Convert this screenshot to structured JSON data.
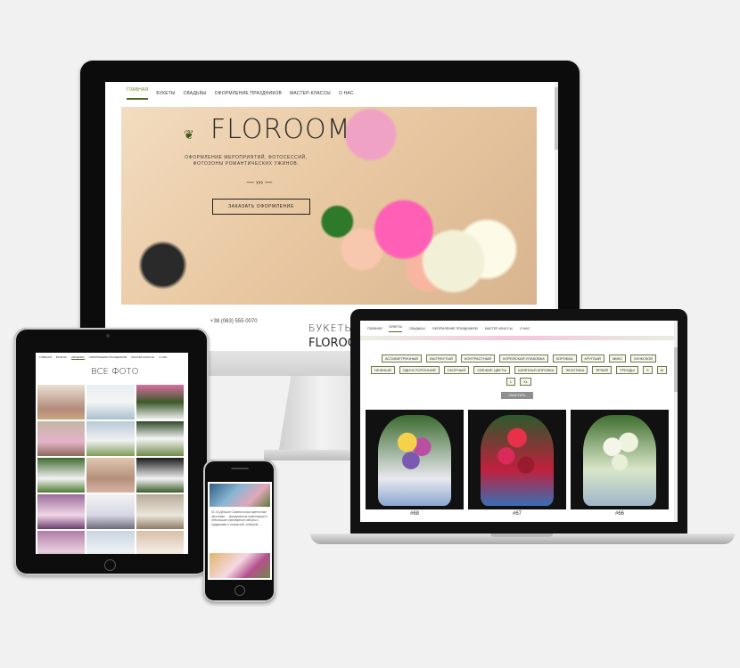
{
  "desktop": {
    "nav": [
      "Главная",
      "Букеты",
      "Свадьбы",
      "Оформление праздников",
      "Мастер-классы",
      "О нас"
    ],
    "nav_active_index": 0,
    "logo_text": "FLOROOM",
    "tagline": "Оформление мероприятий, фотосессий, фотозоны романтических ужинов.",
    "divider": "— ››› —",
    "order_button": "Заказать оформление",
    "phone": "+38 (063) 555 0070",
    "bouquets_heading": "БУКЕТЫ",
    "logo_text_2": "FLOROOM"
  },
  "laptop": {
    "nav": [
      "Главная",
      "Букеты",
      "Свадьбы",
      "Оформление праздников",
      "Мастер-классы",
      "О нас"
    ],
    "nav_active_index": 1,
    "filter_tags": [
      "Ассиметричный",
      "Вытянутый",
      "Контрастный",
      "Корейская упаковка",
      "Коробка",
      "Круглый",
      "Микс",
      "Мужской",
      "Нежный",
      "Односторонний",
      "Сборный",
      "Свежие цветы",
      "Шляпная коробка",
      "Экзотика",
      "Яркий",
      "Тренды",
      "S",
      "M",
      "L",
      "XL"
    ],
    "clear_button": "Очистить",
    "products": [
      {
        "label": "#68"
      },
      {
        "label": "#67"
      },
      {
        "label": "#66"
      }
    ]
  },
  "tablet": {
    "nav": [
      "Главная",
      "Букеты",
      "Свадьбы",
      "Оформление праздников",
      "Мастер-классы",
      "О нас"
    ],
    "nav_active_index": 2,
    "section_title": "ВСЕ ФОТО"
  },
  "phone": {
    "text": "31.03 Деньки! Совсем скоро цветочные заготовки ... праздничные композиции и небольшие сувенирные наборы с подарками и открыткой, соберем ..."
  },
  "colors": {
    "accent_green": "#4f6b2a",
    "tag_border": "#6f7a52",
    "clear_button": "#8e8e8e"
  }
}
